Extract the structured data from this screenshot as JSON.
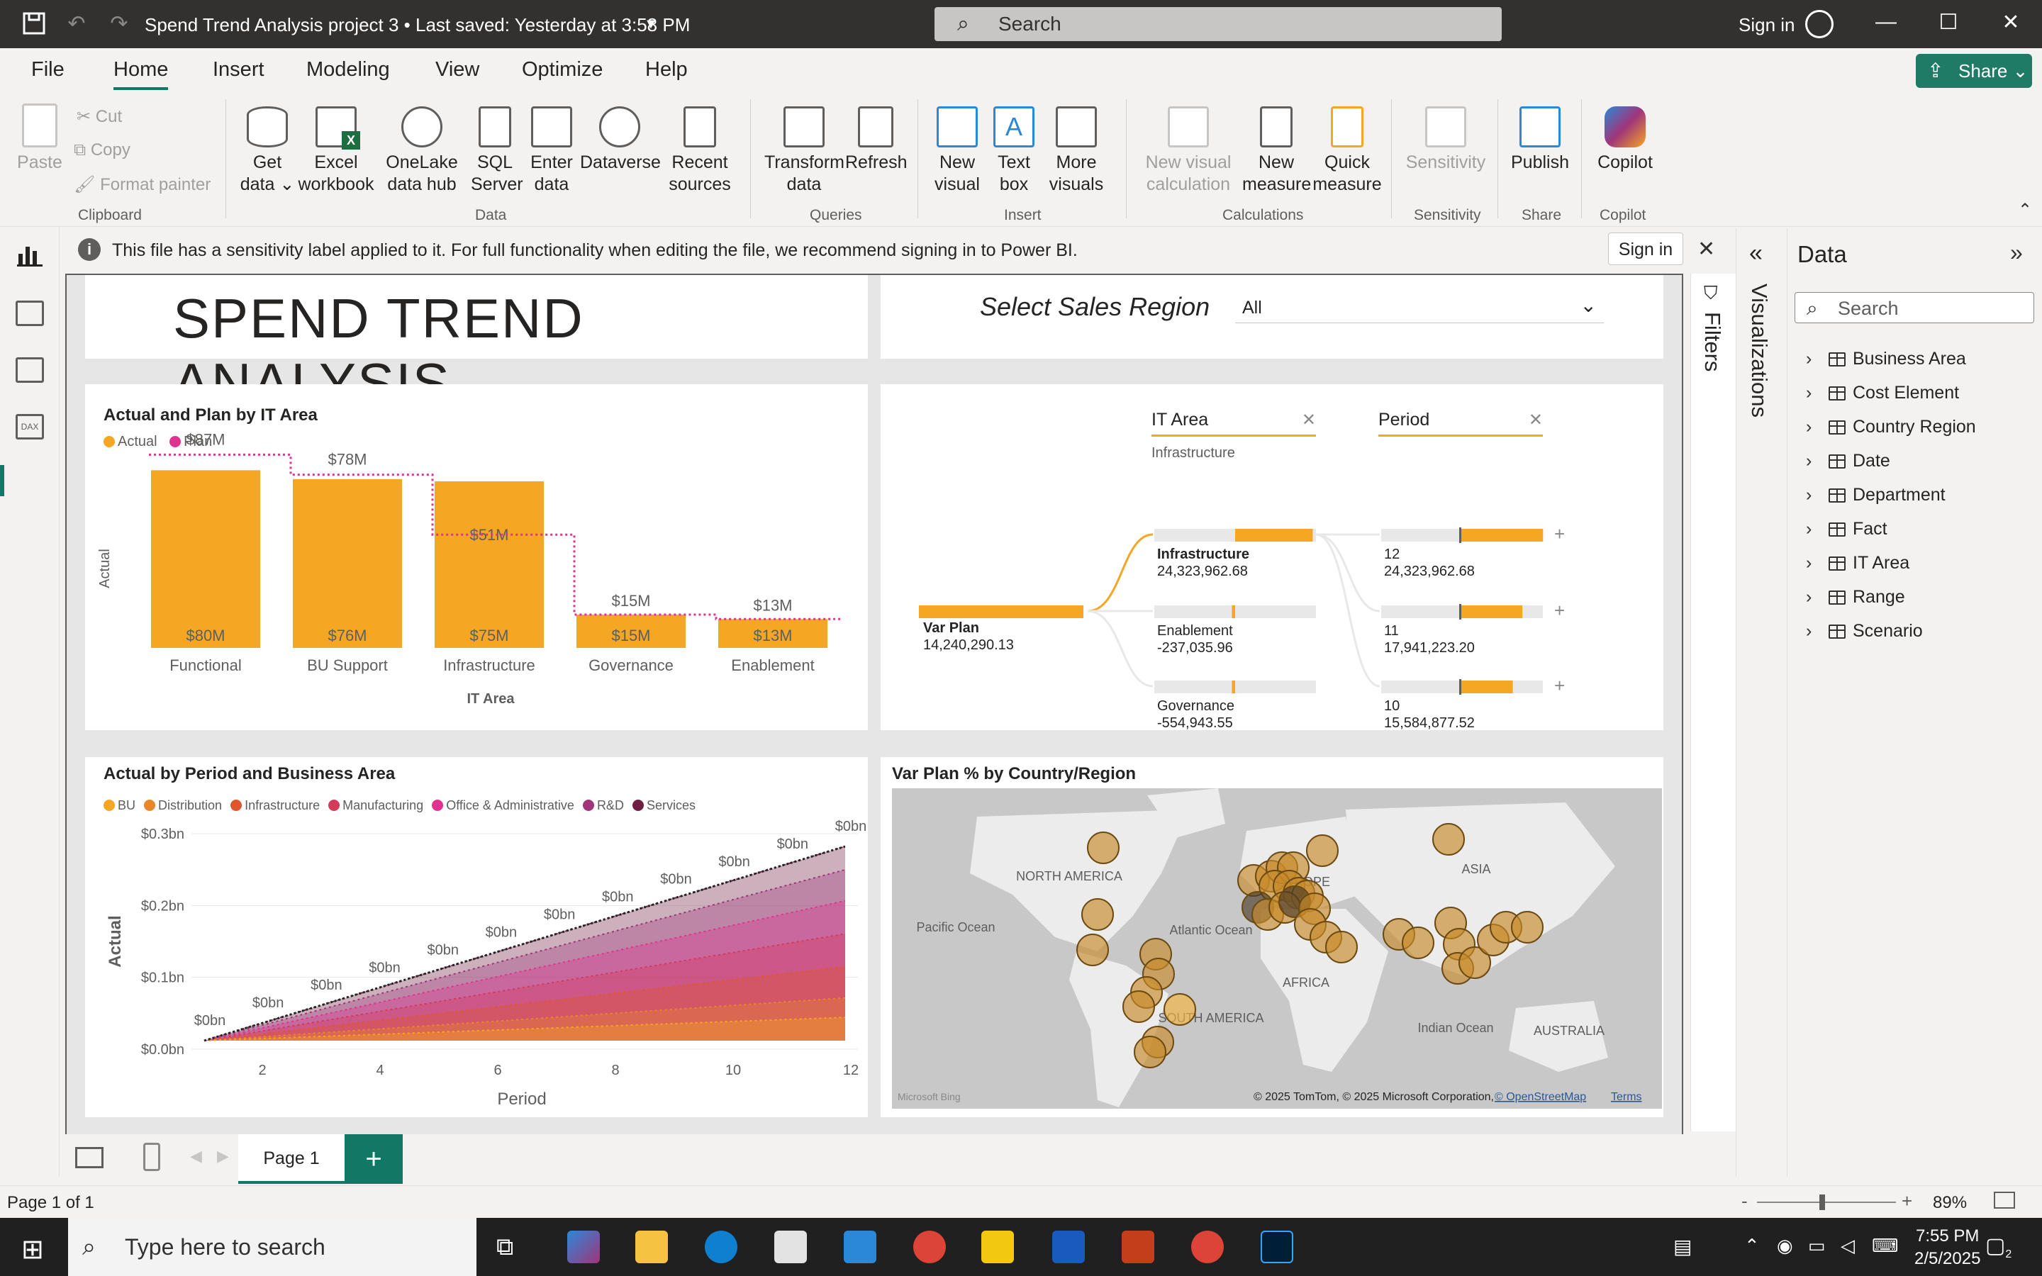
{
  "window": {
    "title": "Spend Trend Analysis project 3 • Last saved: Yesterday at 3:58 PM",
    "search_placeholder": "Search",
    "sign_in": "Sign in"
  },
  "menu": {
    "items": [
      "File",
      "Home",
      "Insert",
      "Modeling",
      "View",
      "Optimize",
      "Help"
    ],
    "active": "Home",
    "share_label": "Share"
  },
  "ribbon": {
    "clipboard": {
      "paste": "Paste",
      "cut": "Cut",
      "copy": "Copy",
      "format_painter": "Format painter",
      "label": "Clipboard"
    },
    "data": {
      "get_data": "Get data",
      "excel": "Excel workbook",
      "onelake": "OneLake data hub",
      "sql": "SQL Server",
      "enter_data": "Enter data",
      "dataverse": "Dataverse",
      "recent": "Recent sources",
      "label": "Data"
    },
    "queries": {
      "transform": "Transform data",
      "refresh": "Refresh",
      "label": "Queries"
    },
    "insert": {
      "new_visual": "New visual",
      "text_box": "Text box",
      "more_visuals": "More visuals",
      "label": "Insert"
    },
    "calculations": {
      "new_visual_calc": "New visual calculation",
      "new_measure": "New measure",
      "quick_measure": "Quick measure",
      "label": "Calculations"
    },
    "sensitivity": {
      "sensitivity": "Sensitivity",
      "label": "Sensitivity"
    },
    "share": {
      "publish": "Publish",
      "label": "Share"
    },
    "copilot": {
      "copilot": "Copilot",
      "label": "Copilot"
    }
  },
  "infobar": {
    "message": "This file has a sensitivity label applied to it. For full functionality when editing the file, we recommend signing in to Power BI.",
    "sign_in": "Sign in"
  },
  "report": {
    "title": "SPEND TREND ANALYSIS",
    "slicer_label": "Select Sales Region",
    "slicer_value": "All"
  },
  "bar_chart": {
    "title": "Actual and Plan by IT Area",
    "legend": [
      {
        "name": "Actual",
        "color": "#f5a623"
      },
      {
        "name": "Plan",
        "color": "#e0338f"
      }
    ],
    "ylabel": "Actual",
    "xlabel": "IT Area"
  },
  "decomp_tree": {
    "col1_header": "IT Area",
    "col1_filter": "Infrastructure",
    "col2_header": "Period",
    "root": {
      "label": "Var Plan",
      "value": "14,240,290.13"
    },
    "level1": [
      {
        "label": "Infrastructure",
        "value": "24,323,962.68",
        "fill": 0.6
      },
      {
        "label": "Enablement",
        "value": "-237,035.96",
        "fill": 0.02
      },
      {
        "label": "Governance",
        "value": "-554,943.55",
        "fill": 0.02
      }
    ],
    "level2": [
      {
        "label": "12",
        "value": "24,323,962.68",
        "fill": 0.6
      },
      {
        "label": "11",
        "value": "17,941,223.20",
        "fill": 0.45
      },
      {
        "label": "10",
        "value": "15,584,877.52",
        "fill": 0.38
      }
    ]
  },
  "area_chart": {
    "title": "Actual by Period and Business Area",
    "legend": [
      {
        "name": "BU",
        "color": "#f5a623"
      },
      {
        "name": "Distribution",
        "color": "#e8862a"
      },
      {
        "name": "Infrastructure",
        "color": "#e0562c"
      },
      {
        "name": "Manufacturing",
        "color": "#d43a5a"
      },
      {
        "name": "Office & Administrative",
        "color": "#e0338f"
      },
      {
        "name": "R&D",
        "color": "#a0357a"
      },
      {
        "name": "Services",
        "color": "#6e1f43"
      }
    ],
    "ylabel": "Actual",
    "xlabel": "Period",
    "yticks": [
      "$0.3bn",
      "$0.2bn",
      "$0.1bn",
      "$0.0bn"
    ],
    "xticks": [
      "2",
      "4",
      "6",
      "8",
      "10",
      "12"
    ],
    "data_label": "$0bn"
  },
  "map": {
    "title": "Var Plan % by Country/Region",
    "labels": [
      "NORTH AMERICA",
      "Pacific Ocean",
      "Atlantic Ocean",
      "EUROPE",
      "ASIA",
      "AFRICA",
      "SOUTH AMERICA",
      "Indian Ocean",
      "AUSTRALIA"
    ],
    "attribution": "© 2025 TomTom, © 2025 Microsoft Corporation,",
    "osm": "© OpenStreetMap",
    "terms": "Terms",
    "bing": "Microsoft Bing"
  },
  "chart_data": {
    "type": "bar",
    "title": "Actual and Plan by IT Area",
    "categories": [
      "Functional",
      "BU Support",
      "Infrastructure",
      "Governance",
      "Enablement"
    ],
    "series": [
      {
        "name": "Actual",
        "values": [
          80,
          76,
          75,
          15,
          13
        ],
        "labels": [
          "$80M",
          "$76M",
          "$75M",
          "$15M",
          "$13M"
        ]
      },
      {
        "name": "Plan",
        "values": [
          87,
          78,
          51,
          15,
          13
        ],
        "labels": [
          "$87M",
          "$78M",
          "$51M",
          "$15M",
          "$13M"
        ]
      }
    ],
    "xlabel": "IT Area",
    "ylabel": "Actual",
    "ylim": [
      0,
      90
    ]
  },
  "panes": {
    "filters": "Filters",
    "visualizations": "Visualizations",
    "data_title": "Data",
    "data_search": "Search",
    "tables": [
      "Business Area",
      "Cost Element",
      "Country Region",
      "Date",
      "Department",
      "Fact",
      "IT Area",
      "Range",
      "Scenario"
    ]
  },
  "pages": {
    "tab": "Page 1"
  },
  "status": {
    "page": "Page 1 of 1",
    "zoom": "89%"
  },
  "taskbar": {
    "search": "Type here to search",
    "time": "7:55 PM",
    "date": "2/5/2025",
    "notif": "2"
  }
}
